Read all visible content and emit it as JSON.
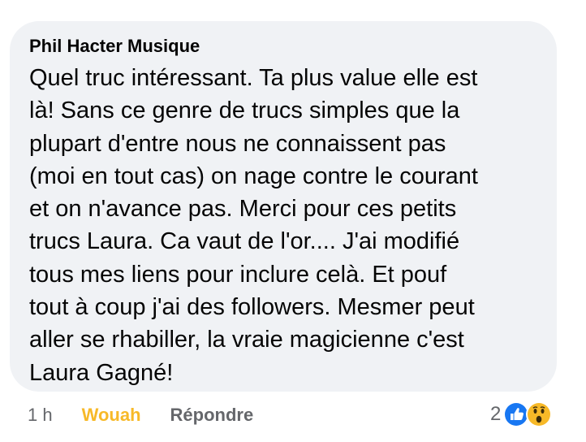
{
  "comment": {
    "author": "Phil Hacter Musique",
    "text": "Quel truc intéressant. Ta plus value elle est\nlà! Sans ce genre de trucs simples que la\nplupart d'entre nous ne connaissent pas\n(moi en tout cas) on nage contre le courant\net on n'avance pas. Merci pour ces petits\ntrucs Laura. Ca vaut de l'or.... J'ai modifié\ntous mes liens pour inclure celà. Et pouf\ntout à coup j'ai des followers. Mesmer peut\naller se rhabiller, la vraie magicienne c'est\nLaura Gagné!"
  },
  "actions": {
    "time": "1 h",
    "reaction_label": "Wouah",
    "reply_label": "Répondre"
  },
  "reactions": {
    "count": "2",
    "icons": [
      "like-icon",
      "wow-icon"
    ]
  },
  "colors": {
    "bubble": "#f0f2f5",
    "wow_label": "#f7b928",
    "like_blue": "#1877f2",
    "secondary_text": "#65676b"
  }
}
